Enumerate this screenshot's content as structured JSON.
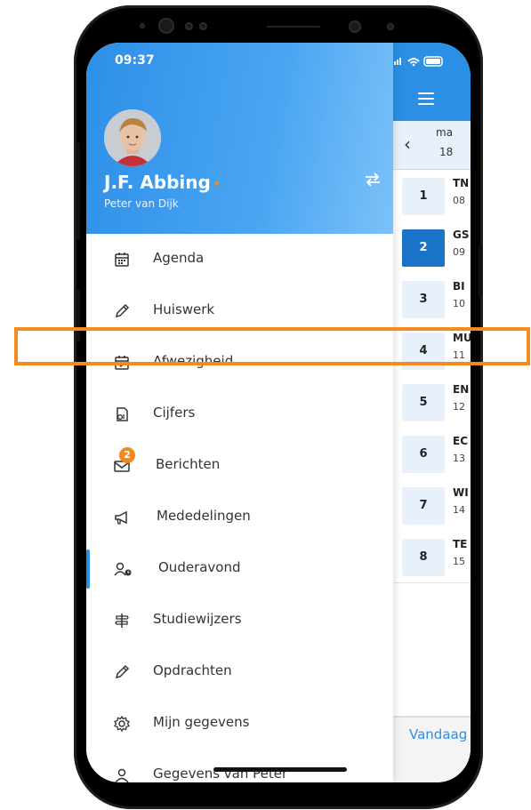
{
  "status_bar": {
    "time": "09:37"
  },
  "profile": {
    "name": "J.F. Abbing",
    "subtitle": "Peter van Dijk"
  },
  "menu": {
    "items": [
      {
        "label": "Agenda",
        "icon": "calendar-icon"
      },
      {
        "label": "Huiswerk",
        "icon": "pencil-icon"
      },
      {
        "label": "Afwezigheid",
        "icon": "calendar-check-icon"
      },
      {
        "label": "Cijfers",
        "icon": "grades-icon"
      },
      {
        "label": "Berichten",
        "icon": "envelope-icon",
        "badge": "2"
      },
      {
        "label": "Mededelingen",
        "icon": "megaphone-icon"
      },
      {
        "label": "Ouderavond",
        "icon": "parent-meeting-icon"
      },
      {
        "label": "Studiewijzers",
        "icon": "signpost-icon"
      },
      {
        "label": "Opdrachten",
        "icon": "pencil-icon"
      },
      {
        "label": "Mijn gegevens",
        "icon": "gear-icon"
      },
      {
        "label": "Gegevens van Peter",
        "icon": "person-icon"
      }
    ]
  },
  "schedule": {
    "day_abbr": "ma",
    "date": "18",
    "lessons": [
      {
        "num": "1",
        "code": "TN",
        "time": "08"
      },
      {
        "num": "2",
        "code": "GS",
        "time": "09"
      },
      {
        "num": "3",
        "code": "BI",
        "time": "10"
      },
      {
        "num": "4",
        "code": "MU",
        "time": "11"
      },
      {
        "num": "5",
        "code": "EN",
        "time": "12"
      },
      {
        "num": "6",
        "code": "EC",
        "time": "13"
      },
      {
        "num": "7",
        "code": "WI",
        "time": "14"
      },
      {
        "num": "8",
        "code": "TE",
        "time": "15"
      }
    ],
    "today_label": "Vandaag"
  },
  "colors": {
    "brand_blue": "#2b8fe5",
    "highlight_orange": "#f58a1f",
    "badge_orange": "#f08a1e",
    "active_lesson": "#1a73c9"
  }
}
